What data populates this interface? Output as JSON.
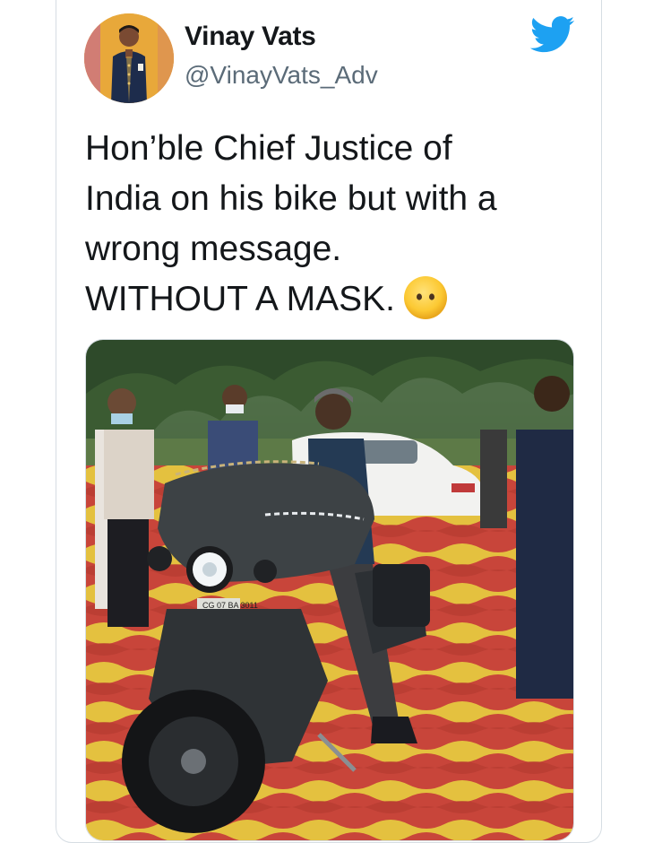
{
  "tweet": {
    "author": {
      "display_name": "Vinay Vats",
      "handle": "@VinayVats_Adv",
      "avatar_icon": "profile-photo"
    },
    "brand_icon": "twitter-bird-icon",
    "brand_color": "#1da1f2",
    "text_lines": [
      "Hon’ble Chief Justice of",
      "India on his bike but with a",
      "wrong message.",
      "WITHOUT A MASK."
    ],
    "trailing_emoji": "face-without-mouth-emoji",
    "media": {
      "type": "photo",
      "plate_text": "CG 07 BA 3011"
    }
  }
}
